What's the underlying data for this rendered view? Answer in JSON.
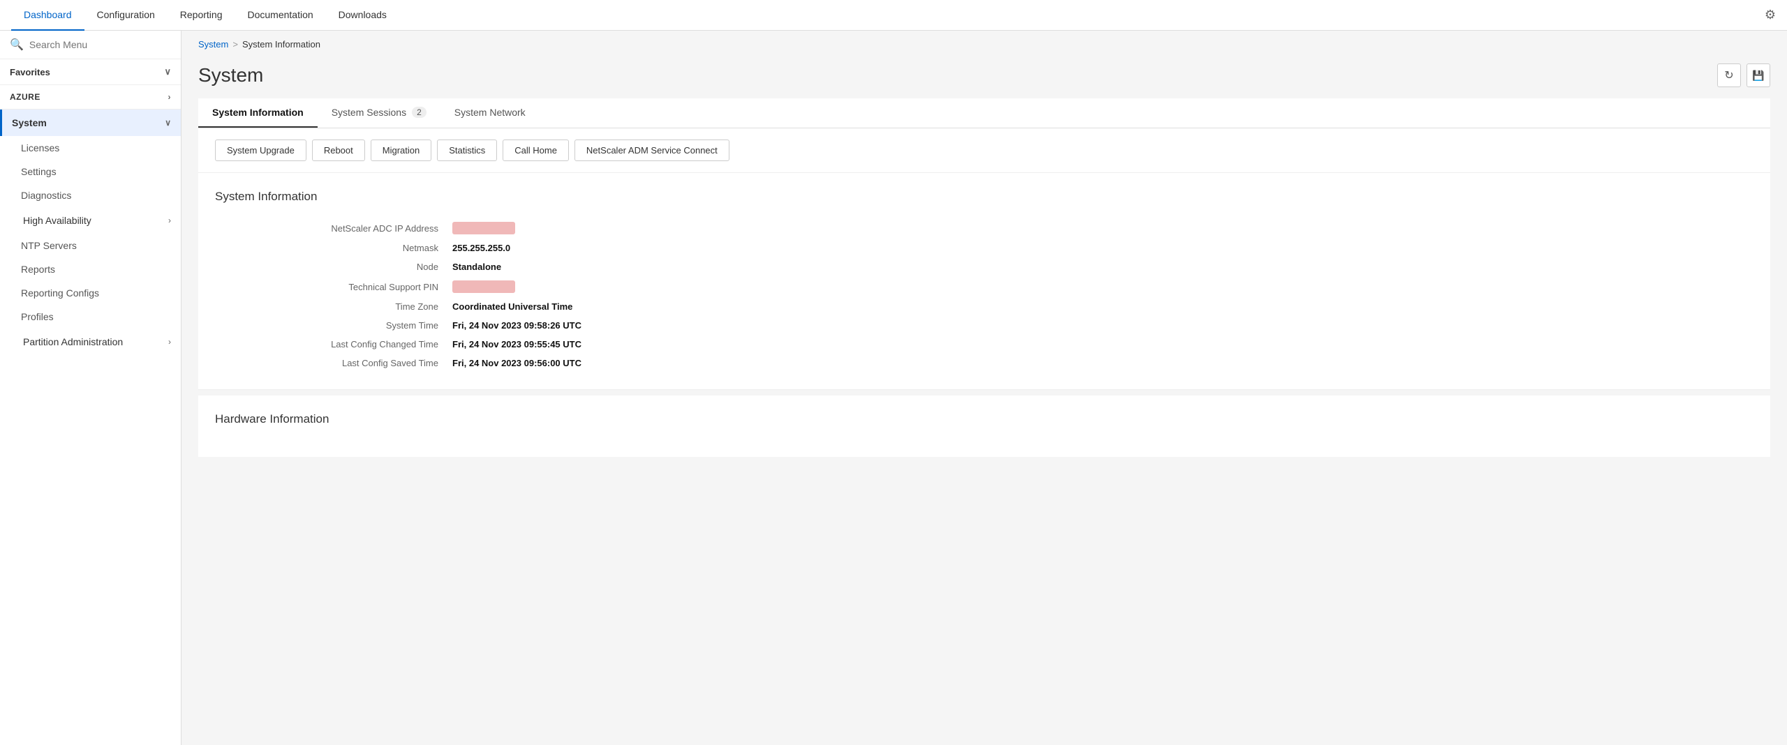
{
  "topNav": {
    "items": [
      {
        "id": "dashboard",
        "label": "Dashboard",
        "active": false
      },
      {
        "id": "configuration",
        "label": "Configuration",
        "active": false
      },
      {
        "id": "reporting",
        "label": "Reporting",
        "active": false
      },
      {
        "id": "documentation",
        "label": "Documentation",
        "active": false
      },
      {
        "id": "downloads",
        "label": "Downloads",
        "active": false
      }
    ]
  },
  "sidebar": {
    "search": {
      "placeholder": "Search Menu"
    },
    "favorites": {
      "label": "Favorites"
    },
    "azure": {
      "label": "AZURE"
    },
    "systemItem": {
      "label": "System"
    },
    "subItems": [
      {
        "label": "Licenses"
      },
      {
        "label": "Settings"
      },
      {
        "label": "Diagnostics"
      },
      {
        "label": "High Availability"
      },
      {
        "label": "NTP Servers"
      },
      {
        "label": "Reports"
      },
      {
        "label": "Reporting Configs"
      },
      {
        "label": "Profiles"
      },
      {
        "label": "Partition Administration"
      }
    ]
  },
  "breadcrumb": {
    "parent": "System",
    "separator": ">",
    "current": "System Information"
  },
  "page": {
    "title": "System",
    "refreshLabel": "↻",
    "saveLabel": "💾"
  },
  "tabs": [
    {
      "id": "system-info",
      "label": "System Information",
      "active": true
    },
    {
      "id": "system-sessions",
      "label": "System Sessions",
      "badge": "2",
      "active": false
    },
    {
      "id": "system-network",
      "label": "System Network",
      "active": false
    }
  ],
  "actionButtons": [
    {
      "id": "system-upgrade",
      "label": "System Upgrade"
    },
    {
      "id": "reboot",
      "label": "Reboot"
    },
    {
      "id": "migration",
      "label": "Migration"
    },
    {
      "id": "statistics",
      "label": "Statistics"
    },
    {
      "id": "call-home",
      "label": "Call Home"
    },
    {
      "id": "netscaler-adm",
      "label": "NetScaler ADM Service Connect"
    }
  ],
  "systemInfo": {
    "sectionTitle": "System Information",
    "fields": [
      {
        "label": "NetScaler ADC IP Address",
        "value": "",
        "redacted": true
      },
      {
        "label": "Netmask",
        "value": "255.255.255.0",
        "redacted": false
      },
      {
        "label": "Node",
        "value": "Standalone",
        "redacted": false
      },
      {
        "label": "Technical Support PIN",
        "value": "",
        "redacted": true
      },
      {
        "label": "Time Zone",
        "value": "Coordinated Universal Time",
        "redacted": false
      },
      {
        "label": "System Time",
        "value": "Fri, 24 Nov 2023 09:58:26 UTC",
        "redacted": false
      },
      {
        "label": "Last Config Changed Time",
        "value": "Fri, 24 Nov 2023 09:55:45 UTC",
        "redacted": false
      },
      {
        "label": "Last Config Saved Time",
        "value": "Fri, 24 Nov 2023 09:56:00 UTC",
        "redacted": false
      }
    ]
  },
  "hardwareInfo": {
    "sectionTitle": "Hardware Information"
  }
}
